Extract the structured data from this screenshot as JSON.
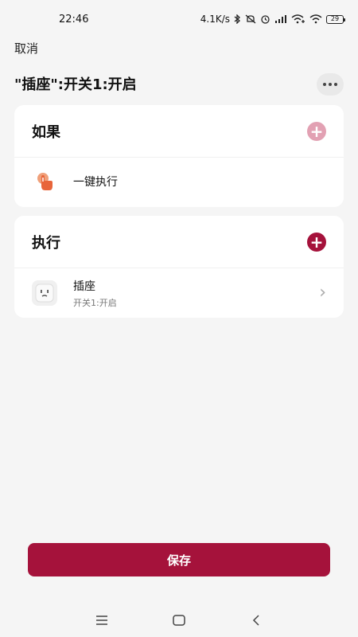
{
  "status_bar": {
    "time": "22:46",
    "network_speed": "4.1K/s",
    "battery": "29",
    "icons": [
      "bluetooth-icon",
      "mute-icon",
      "alarm-icon",
      "signal-icon",
      "wifi-plus-icon",
      "wifi-icon",
      "battery-icon"
    ]
  },
  "header": {
    "cancel_label": "取消",
    "title": "\"插座\":开关1:开启",
    "more_icon": "more-icon"
  },
  "if_card": {
    "title": "如果",
    "add_icon": "plus-icon",
    "add_color": "#e2a1b3",
    "items": [
      {
        "label": "一键执行",
        "icon": "tap-hand-icon"
      }
    ]
  },
  "do_card": {
    "title": "执行",
    "add_icon": "plus-icon",
    "add_color": "#a5123b",
    "items": [
      {
        "label": "插座",
        "sub": "开关1:开启",
        "icon": "socket-icon"
      }
    ]
  },
  "footer": {
    "save_label": "保存",
    "accent": "#a5123b"
  },
  "nav_bar": {
    "icons": [
      "menu-icon",
      "home-icon",
      "back-icon"
    ]
  }
}
